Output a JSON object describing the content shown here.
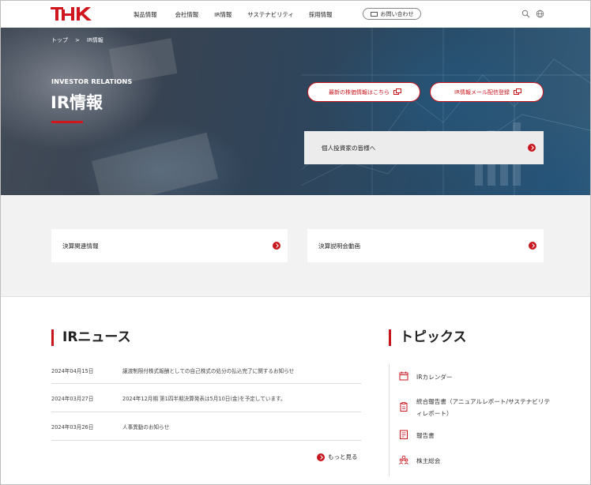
{
  "header": {
    "logo": "THK",
    "nav": [
      "製品情報",
      "会社情報",
      "IR情報",
      "サステナビリティ",
      "採用情報"
    ],
    "contact_label": "お問い合わせ",
    "search_icon": "search-icon",
    "globe_icon": "globe-icon"
  },
  "hero": {
    "breadcrumb": [
      "トップ",
      "IR情報"
    ],
    "eyebrow": "INVESTOR RELATIONS",
    "title": "IR情報",
    "buttons": [
      "最新の株価情報はこちら",
      "IR情報メール配信登録"
    ],
    "individual_label": "個人投資家の皆様へ"
  },
  "cards": [
    "決算関連情報",
    "決算説明会動画"
  ],
  "news": {
    "heading": "IRニュース",
    "items": [
      {
        "date": "2024年04月15日",
        "text": "譲渡制限付株式報酬としての自己株式の処分の払込完了に関するお知らせ"
      },
      {
        "date": "2024年03月27日",
        "text": "2024年12月期 第1四半期決算発表は5月10日(金)を予定しています。"
      },
      {
        "date": "2024年03月26日",
        "text": "人事異動のお知らせ"
      }
    ],
    "more_label": "もっと見る"
  },
  "topics": {
    "heading": "トピックス",
    "items": [
      {
        "label": "IRカレンダー",
        "icon": "calendar-icon"
      },
      {
        "label": "統合報告書（アニュアルレポート/サステナビリティレポート）",
        "icon": "clipboard-icon"
      },
      {
        "label": "報告書",
        "icon": "report-icon"
      },
      {
        "label": "株主総会",
        "icon": "people-icon"
      }
    ]
  },
  "colors": {
    "accent": "#c9161e",
    "band": "#f2f2f2"
  }
}
